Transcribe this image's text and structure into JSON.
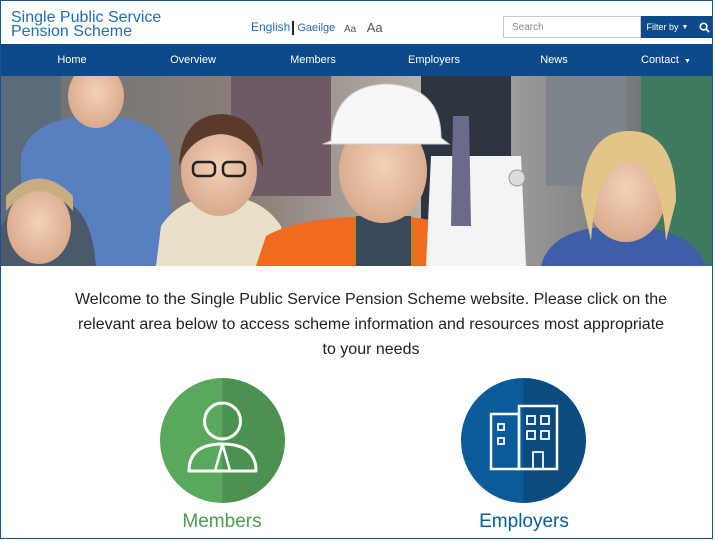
{
  "header": {
    "logo_line1": "Single Public Service",
    "logo_line2": "Pension Scheme",
    "lang_english": "English",
    "lang_irish": "Gaeilge",
    "font_small": "Aa",
    "font_large": "Aa",
    "search_placeholder": "Search",
    "filter_label": "Filter by"
  },
  "nav": {
    "items": [
      {
        "label": "Home"
      },
      {
        "label": "Overview"
      },
      {
        "label": "Members"
      },
      {
        "label": "Employers"
      },
      {
        "label": "News"
      },
      {
        "label": "Contact"
      }
    ]
  },
  "main": {
    "welcome_text": "Welcome to the Single Public Service Pension Scheme website. Please click on the relevant area below to access scheme information and resources most appropriate to your needs",
    "tiles": [
      {
        "label": "Members",
        "icon": "person-icon",
        "color": "#5aa85e"
      },
      {
        "label": "Employers",
        "icon": "building-icon",
        "color": "#0b5a99"
      }
    ]
  },
  "colors": {
    "brand_blue": "#0b4a8b",
    "link_blue": "#1f6db5",
    "members_green": "#5aa85e",
    "employers_blue": "#0b5a99"
  }
}
